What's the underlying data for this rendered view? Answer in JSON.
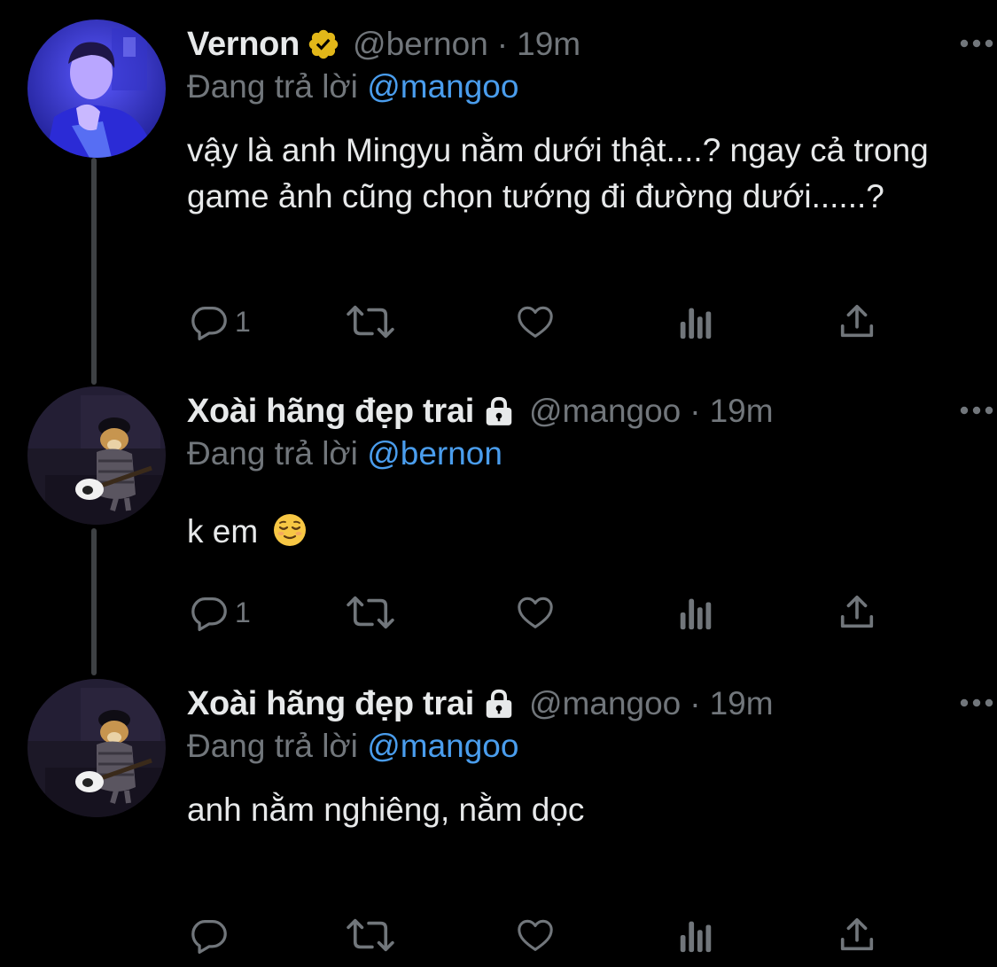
{
  "thread": [
    {
      "author": {
        "name": "Vernon",
        "handle": "@bernon",
        "verified": true,
        "locked": false,
        "avatar": "person-in-blue-jacket-avatar"
      },
      "dot": "·",
      "time": "19m",
      "replying_prefix": "Đang trả lời",
      "replying_to": "@mangoo",
      "text": "vậy là anh Mingyu nằm dưới thật....? ngay cả trong game ảnh cũng chọn tướng đi đường dưới......?",
      "emoji": "",
      "reply_count": "1"
    },
    {
      "author": {
        "name": "Xoài hãng đẹp trai",
        "handle": "@mangoo",
        "verified": false,
        "locked": true,
        "avatar": "cheems-dog-guitar-avatar"
      },
      "dot": "·",
      "time": "19m",
      "replying_prefix": "Đang trả lời",
      "replying_to": "@bernon",
      "text": "k em",
      "emoji": "relieved-face-emoji",
      "reply_count": "1"
    },
    {
      "author": {
        "name": "Xoài hãng đẹp trai",
        "handle": "@mangoo",
        "verified": false,
        "locked": true,
        "avatar": "cheems-dog-guitar-avatar"
      },
      "dot": "·",
      "time": "19m",
      "replying_prefix": "Đang trả lời",
      "replying_to": "@mangoo",
      "text": "anh nằm nghiêng, nằm dọc",
      "emoji": "",
      "reply_count": ""
    }
  ],
  "icons": {
    "reply": "reply-icon",
    "retweet": "retweet-icon",
    "like": "like-icon",
    "views": "views-icon",
    "share": "share-icon",
    "more": "more-icon",
    "verified": "verified-badge-icon",
    "lock": "lock-icon"
  },
  "colors": {
    "background": "#000000",
    "text": "#e7e9ea",
    "muted": "#71767b",
    "link": "#4a9ded",
    "verified_gold": "#e2b719",
    "thread_line": "#3e4144"
  }
}
